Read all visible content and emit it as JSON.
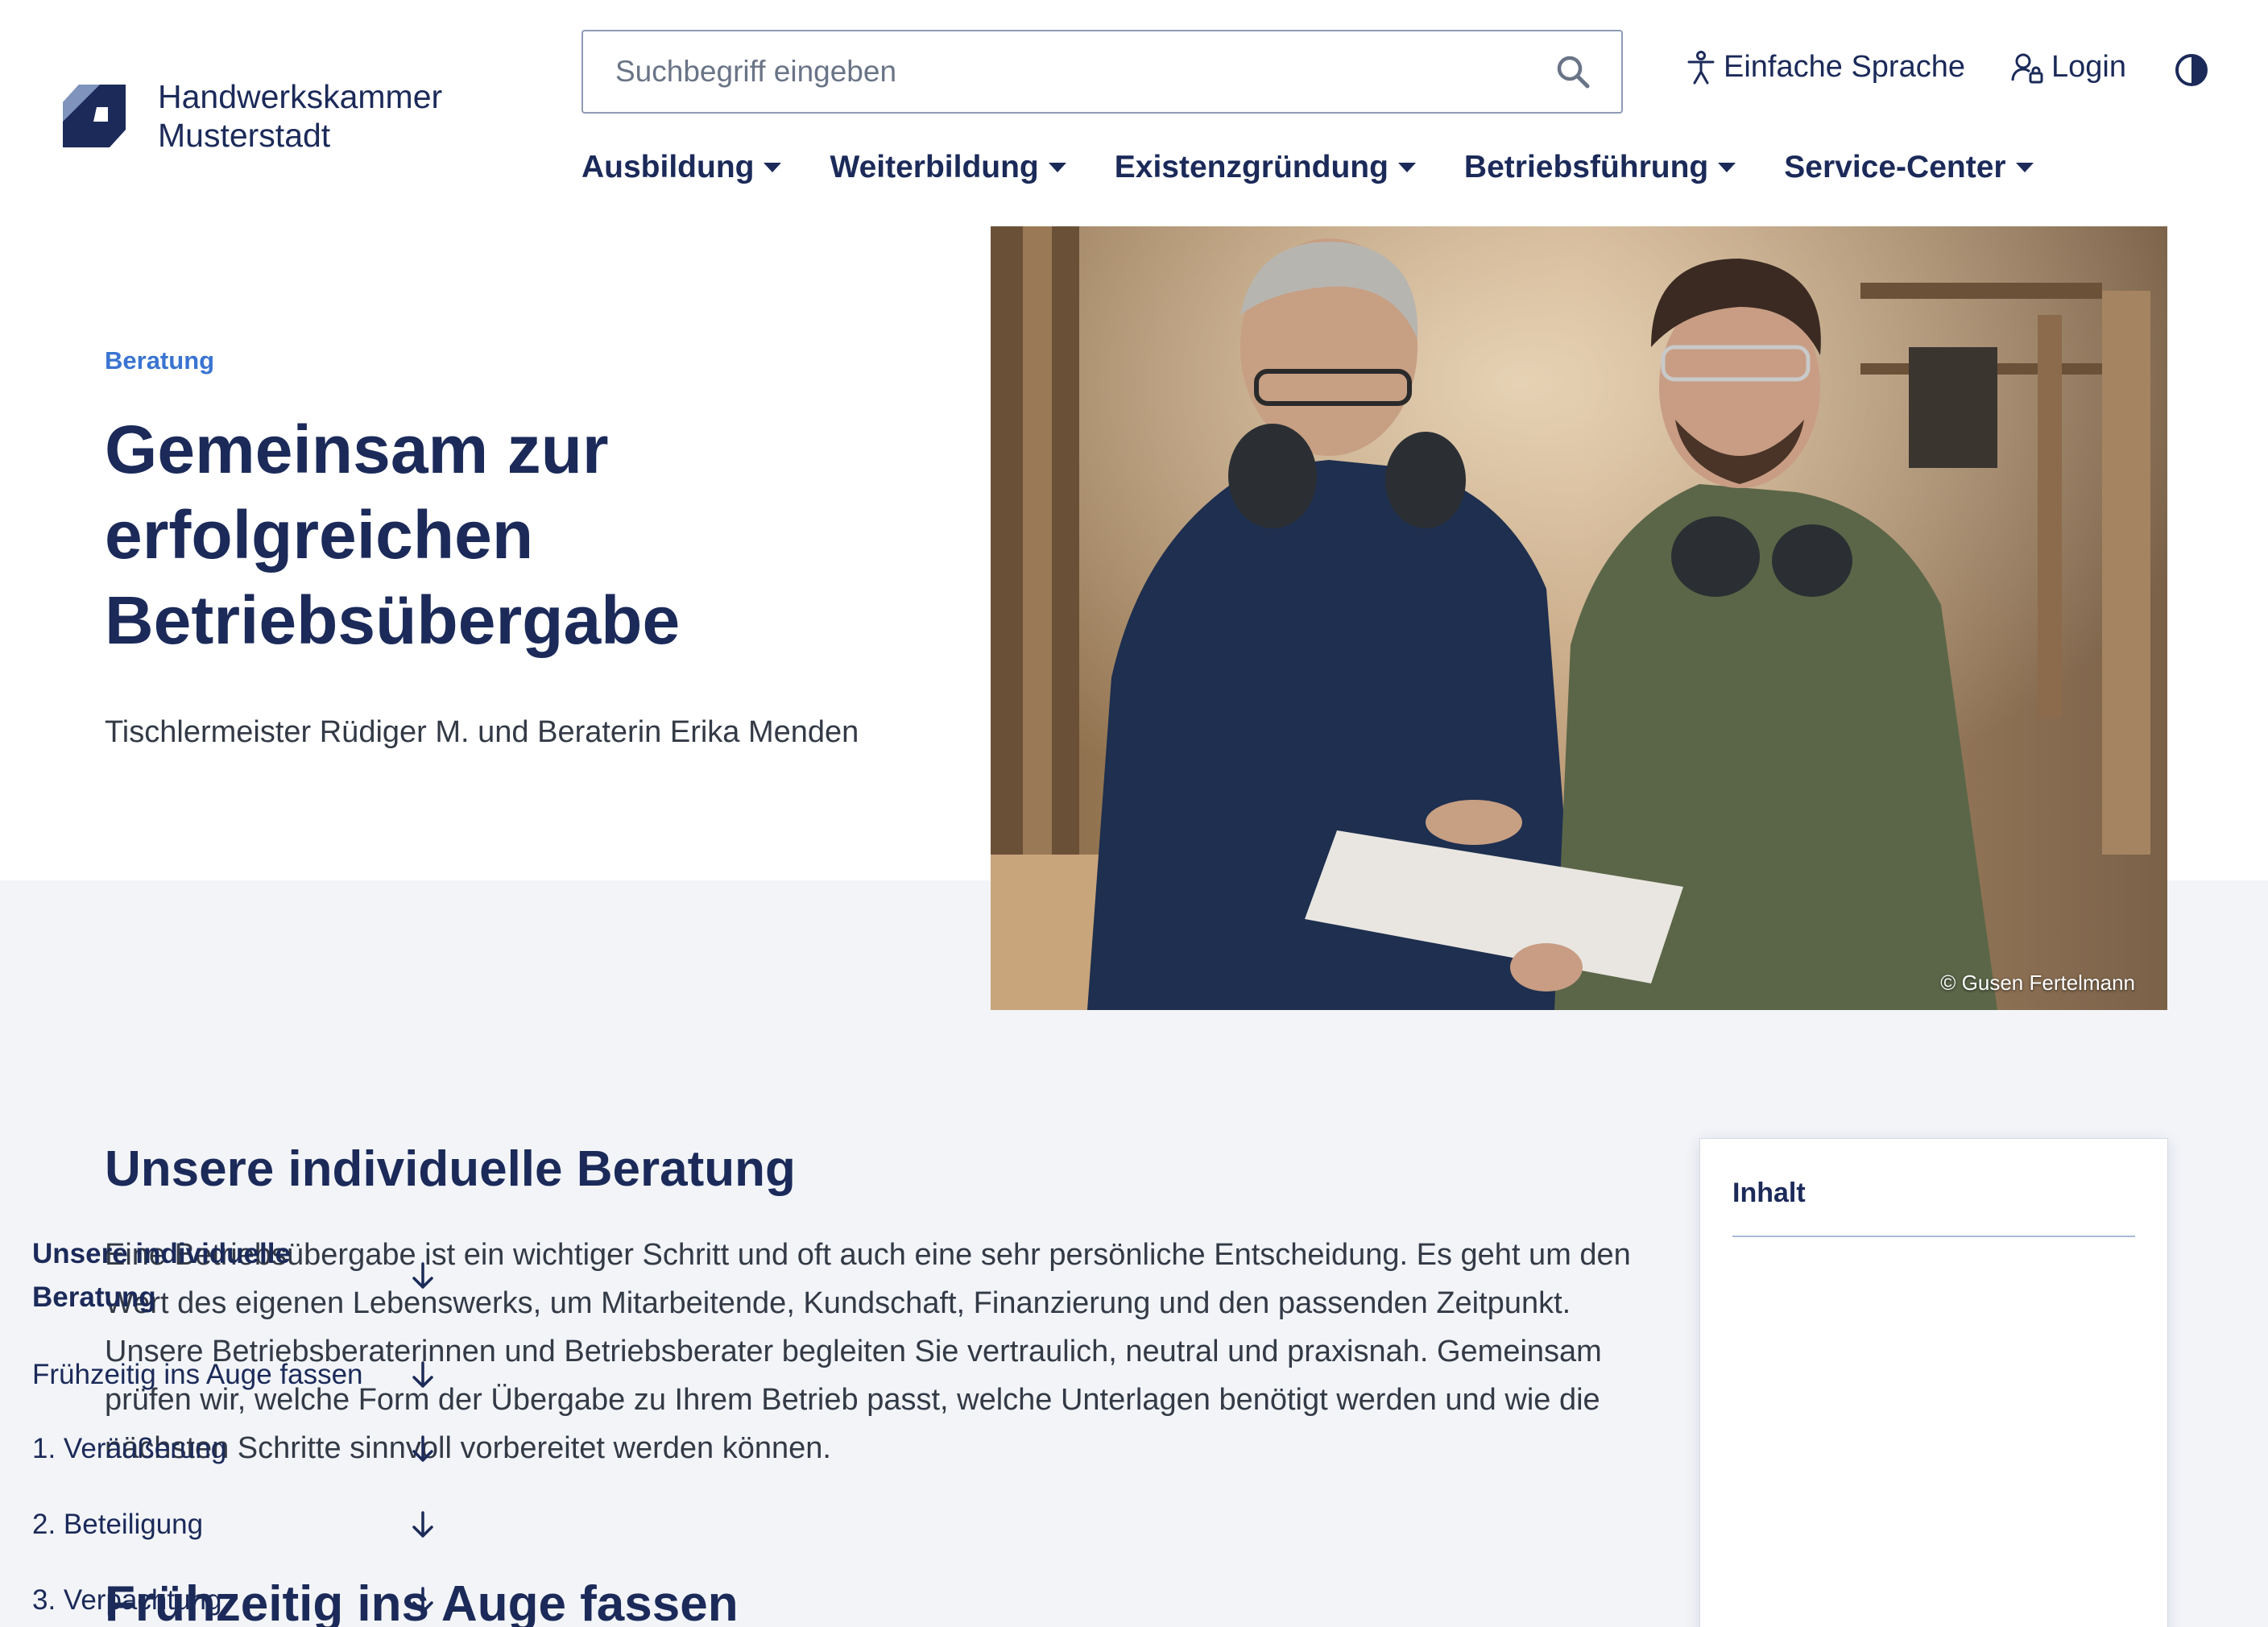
{
  "logo": {
    "line1": "Handwerkskammer",
    "line2": "Musterstadt"
  },
  "search": {
    "placeholder": "Suchbegriff eingeben"
  },
  "utility": {
    "easy_language": "Einfache Sprache",
    "login": "Login"
  },
  "nav": [
    {
      "label": "Ausbildung"
    },
    {
      "label": "Weiterbildung"
    },
    {
      "label": "Existenzgründung"
    },
    {
      "label": "Betriebsführung"
    },
    {
      "label": "Service-Center"
    }
  ],
  "hero": {
    "eyebrow": "Beratung",
    "title": "Gemeinsam zur erfolgreichen Betriebsübergabe",
    "subtitle": "Tischlermeister Rüdiger M. und Beraterin Erika Menden",
    "image_credit": "© Gusen Fertelmann"
  },
  "content": {
    "section1_title": "Unsere individuelle Beratung",
    "section1_text": "Eine Betriebsübergabe ist ein wichtiger Schritt und oft auch eine sehr persönliche Entscheidung. Es geht um den Wert des eigenen Lebenswerks, um Mitarbeitende, Kundschaft, Finanzierung und den passenden Zeitpunkt. Unsere Betriebsberaterinnen und Betriebsberater begleiten Sie vertraulich, neutral und praxisnah. Gemeinsam prüfen wir, welche Form der Übergabe zu Ihrem Betrieb passt, welche Unterlagen benötigt werden und wie die nächsten Schritte sinnvoll vorbereitet werden können.",
    "section2_title": "Frühzeitig ins Auge fassen"
  },
  "toc": {
    "heading": "Inhalt",
    "items": [
      {
        "label": "Unsere individuelle Beratung"
      },
      {
        "label": "Frühzeitig ins Auge fassen"
      },
      {
        "label": "1. Veräußerung"
      },
      {
        "label": "2. Beteiligung"
      },
      {
        "label": "3. Verpachtung"
      }
    ]
  },
  "colors": {
    "primary": "#1b2a59",
    "accent": "#3a74d1",
    "section_bg": "#f2f4f8"
  }
}
